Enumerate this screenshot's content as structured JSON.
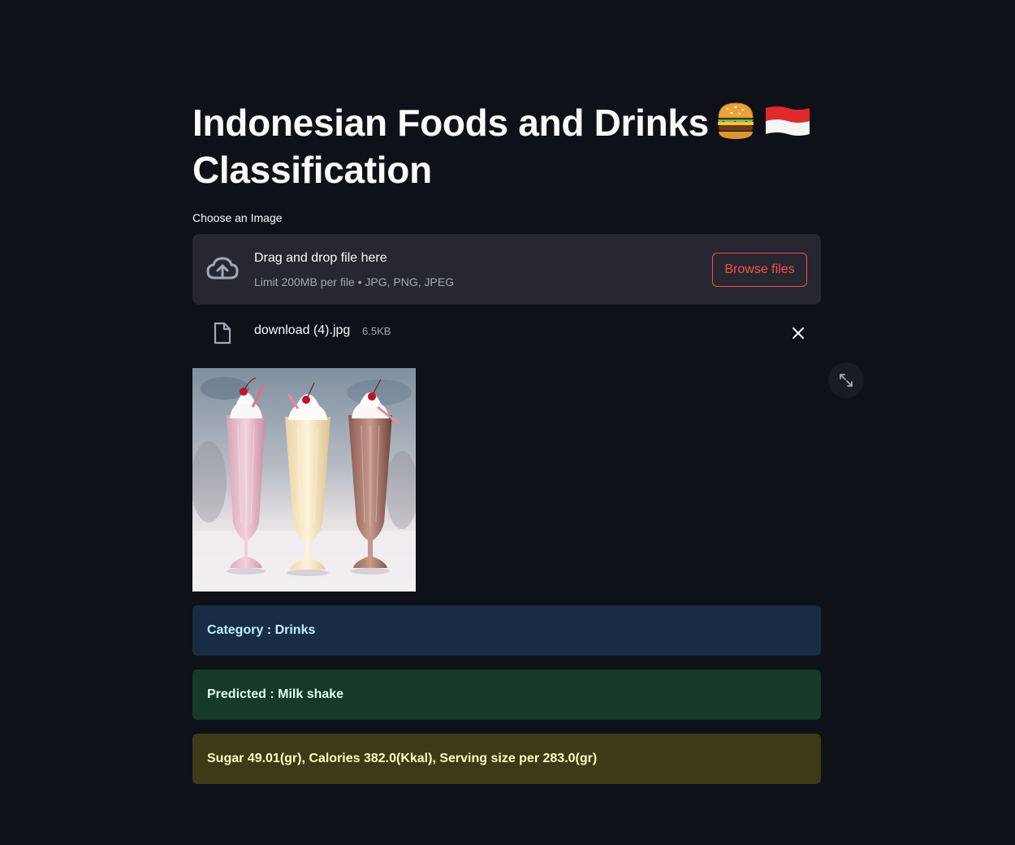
{
  "page": {
    "title": "Indonesian Foods and Drinks",
    "title_line2": "Classification",
    "title_icons": [
      "burger-emoji",
      "indonesia-flag-emoji"
    ]
  },
  "uploader": {
    "label": "Choose an Image",
    "instructions": "Drag and drop file here",
    "limit": "Limit 200MB per file • JPG, PNG, JPEG",
    "browse_label": "Browse files",
    "icon": "cloud-upload-icon"
  },
  "uploaded_file": {
    "name": "download (4).jpg",
    "size": "6.5KB",
    "icon": "file-icon"
  },
  "results": {
    "category": "Category : Drinks",
    "predicted": "Predicted : Milk shake",
    "nutrition": "Sugar 49.01(gr), Calories 382.0(Kkal), Serving size per 283.0(gr)"
  },
  "colors": {
    "background": "#0e1117",
    "accent": "#ff4b4b",
    "info_bg": "#172d43",
    "success_bg": "#173928",
    "warning_bg": "#3e3a16"
  }
}
